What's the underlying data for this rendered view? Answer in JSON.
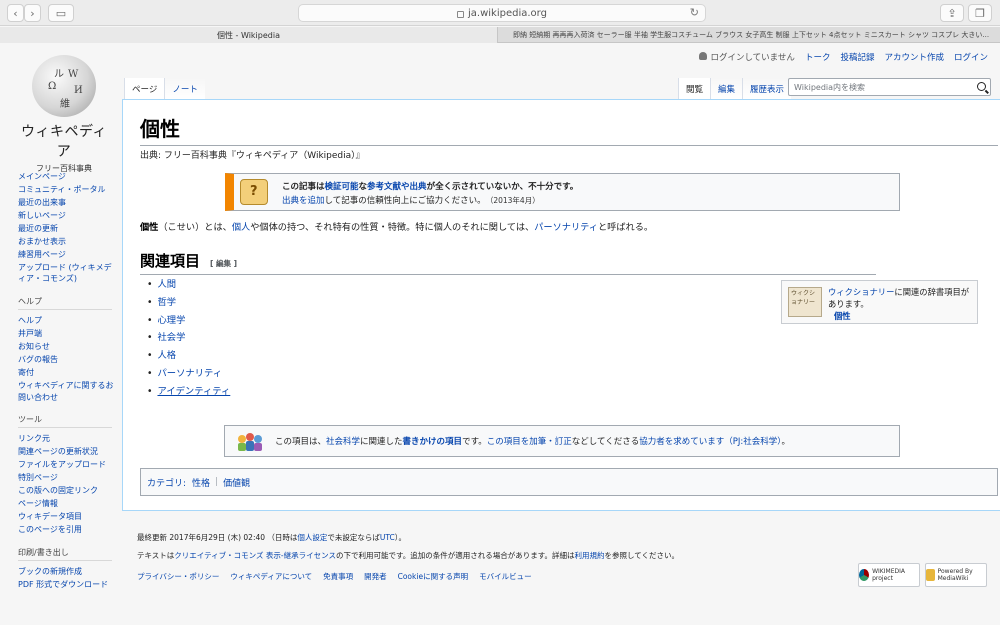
{
  "browser": {
    "url": "ja.wikipedia.org",
    "active_tab": "個性 - Wikipedia",
    "inactive_tab": "即納 短納期 再再再入荷済 セーラー服 半袖 学生服コスチューム ブラウス 女子高生 制服 上下セット 4点セット ミニスカート シャツ コスプレ 大きい..."
  },
  "logo": {
    "title": "ウィキペディア",
    "tagline": "フリー百科事典",
    "globe_glyphs": [
      "W",
      "Ω",
      "ル",
      "И",
      "維"
    ]
  },
  "user_links": {
    "not_logged_in": "ログインしていません",
    "talk": "トーク",
    "contributions": "投稿記録",
    "create_account": "アカウント作成",
    "login": "ログイン"
  },
  "tabs": {
    "page": "ページ",
    "note": "ノート",
    "read": "閲覧",
    "edit": "編集",
    "history": "履歴表示"
  },
  "search": {
    "placeholder": "Wikipedia内を検索"
  },
  "sidebar": {
    "main": [
      "メインページ",
      "コミュニティ・ポータル",
      "最近の出来事",
      "新しいページ",
      "最近の更新",
      "おまかせ表示",
      "練習用ページ",
      "アップロード (ウィキメディア・コモンズ)"
    ],
    "help_heading": "ヘルプ",
    "help": [
      "ヘルプ",
      "井戸端",
      "お知らせ",
      "バグの報告",
      "寄付",
      "ウィキペディアに関するお問い合わせ"
    ],
    "tools_heading": "ツール",
    "tools": [
      "リンク元",
      "関連ページの更新状況",
      "ファイルをアップロード",
      "特別ページ",
      "この版への固定リンク",
      "ページ情報",
      "ウィキデータ項目",
      "このページを引用"
    ],
    "print_heading": "印刷/書き出し",
    "print": [
      "ブックの新規作成",
      "PDF 形式でダウンロード"
    ]
  },
  "article": {
    "title": "個性",
    "site_sub": "出典: フリー百科事典『ウィキペディア（Wikipedia）』",
    "ambox": {
      "line1_pre": "この記事は",
      "verifiable": "検証可能",
      "line1_mid": "な",
      "references": "参考文献や出典",
      "line1_post": "が全く示されていないか、不十分です。",
      "add_sources": "出典を追加",
      "line2_post": "して記事の信頼性向上にご協力ください。",
      "date": "（2013年4月）"
    },
    "intro": {
      "term": "個性",
      "reading": "（こせい）とは、",
      "link1": "個人",
      "mid": "や個体の持つ、それ特有の性質・特徴。特に個人のそれに関しては、",
      "link2": "パーソナリティ",
      "end": "と呼ばれる。"
    },
    "section_title": "関連項目",
    "section_edit": "[ 編集 ]",
    "related": [
      "人間",
      "哲学",
      "心理学",
      "社会学",
      "人格",
      "パーソナリティ",
      "アイデンティティ"
    ],
    "wiktionary": {
      "link": "ウィクショナリー",
      "text": "に関連の辞書項目があります。",
      "word": "個性",
      "icon_text": "ウィクショナリー"
    },
    "stub": {
      "pre": "この項目は、",
      "social_science": "社会科学",
      "mid1": "に関連した",
      "stub_link": "書きかけの項目",
      "mid2": "です。",
      "edit_link": "この項目を加筆・訂正",
      "mid3": "などしてくださる",
      "helpers": "協力者を求めています",
      "project": "（PJ:社会科学）",
      "end": "。"
    },
    "categories": {
      "label": "カテゴリ:",
      "items": [
        "性格",
        "価値観"
      ]
    }
  },
  "footer": {
    "last_modified": "最終更新 2017年6月29日 (木) 02:40 （日時は",
    "personal_settings": "個人設定",
    "lm_mid": "で未設定ならば",
    "utc": "UTC",
    "lm_end": "）。",
    "license_pre": "テキストは",
    "license": "クリエイティブ・コモンズ 表示-継承ライセンス",
    "license_mid": "の下で利用可能です。追加の条件が適用される場合があります。詳細は",
    "terms": "利用規約",
    "license_end": "を参照してください。",
    "links": [
      "プライバシー・ポリシー",
      "ウィキペディアについて",
      "免責事項",
      "開発者",
      "Cookieに関する声明",
      "モバイルビュー"
    ],
    "badge_wikimedia": "WIKIMEDIA project",
    "badge_mediawiki": "Powered By MediaWiki"
  }
}
